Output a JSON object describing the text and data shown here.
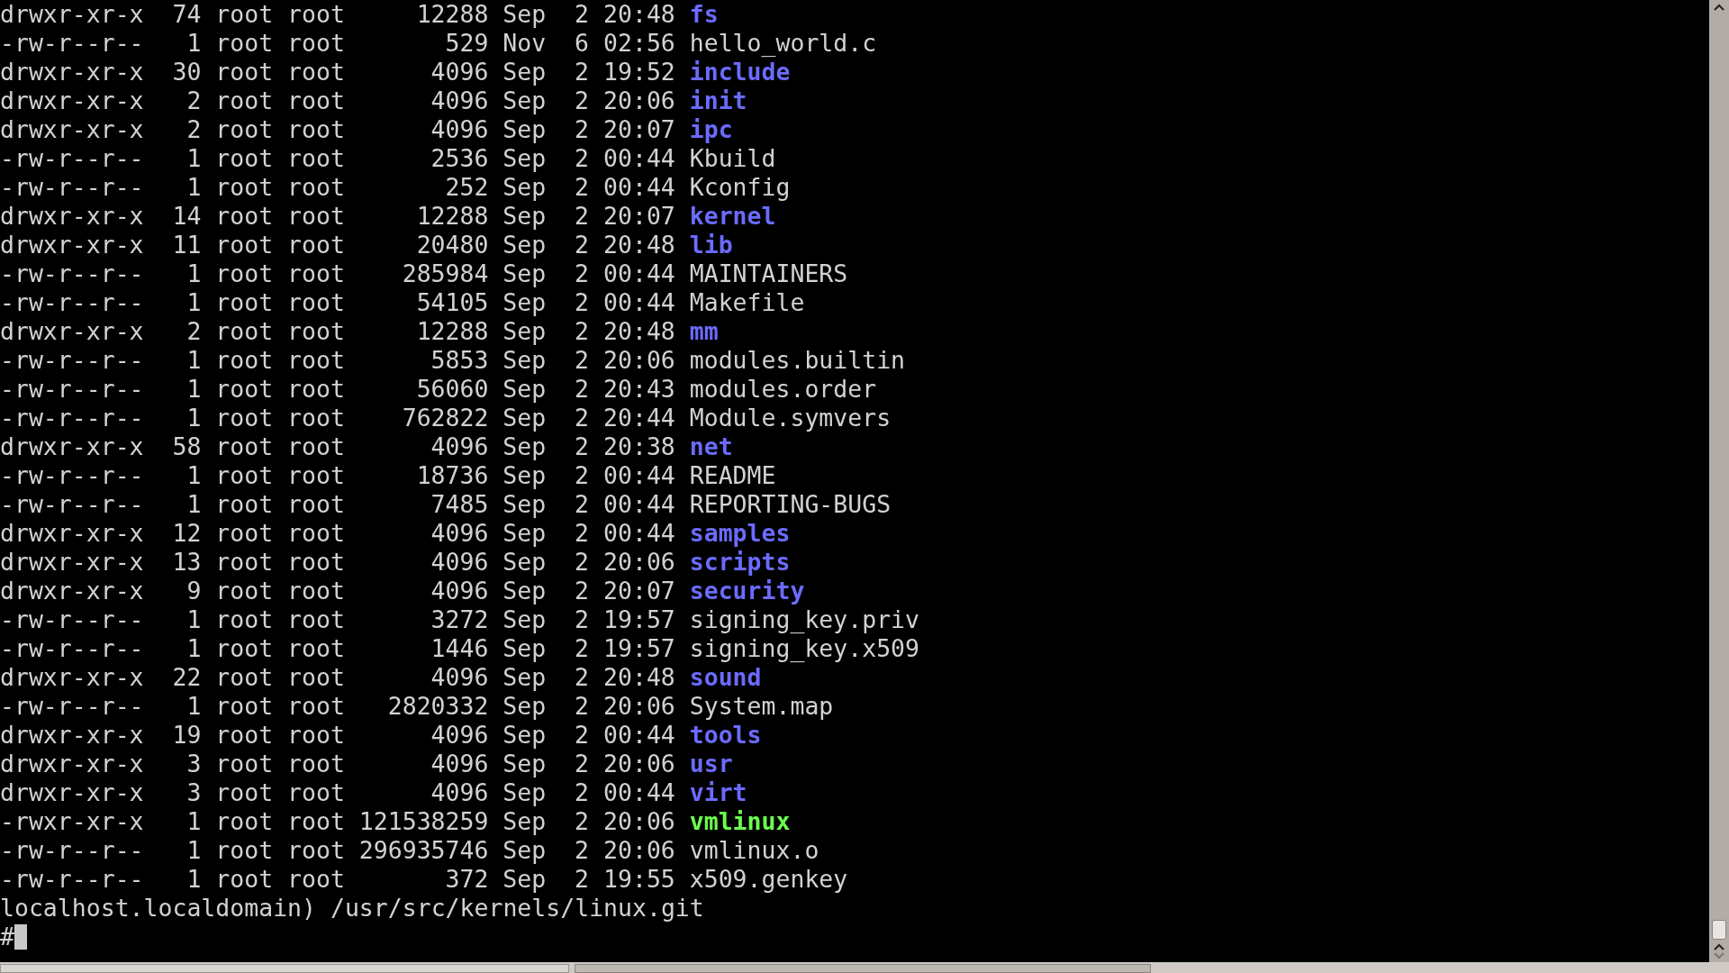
{
  "listing": [
    {
      "perms": "drwxr-xr-x",
      "links": "74",
      "owner": "root",
      "group": "root",
      "size": "12288",
      "month": "Sep",
      "day": "2",
      "time": "20:48",
      "name": "fs",
      "kind": "dir"
    },
    {
      "perms": "-rw-r--r--",
      "links": "1",
      "owner": "root",
      "group": "root",
      "size": "529",
      "month": "Nov",
      "day": "6",
      "time": "02:56",
      "name": "hello_world.c",
      "kind": "file"
    },
    {
      "perms": "drwxr-xr-x",
      "links": "30",
      "owner": "root",
      "group": "root",
      "size": "4096",
      "month": "Sep",
      "day": "2",
      "time": "19:52",
      "name": "include",
      "kind": "dir"
    },
    {
      "perms": "drwxr-xr-x",
      "links": "2",
      "owner": "root",
      "group": "root",
      "size": "4096",
      "month": "Sep",
      "day": "2",
      "time": "20:06",
      "name": "init",
      "kind": "dir"
    },
    {
      "perms": "drwxr-xr-x",
      "links": "2",
      "owner": "root",
      "group": "root",
      "size": "4096",
      "month": "Sep",
      "day": "2",
      "time": "20:07",
      "name": "ipc",
      "kind": "dir"
    },
    {
      "perms": "-rw-r--r--",
      "links": "1",
      "owner": "root",
      "group": "root",
      "size": "2536",
      "month": "Sep",
      "day": "2",
      "time": "00:44",
      "name": "Kbuild",
      "kind": "file"
    },
    {
      "perms": "-rw-r--r--",
      "links": "1",
      "owner": "root",
      "group": "root",
      "size": "252",
      "month": "Sep",
      "day": "2",
      "time": "00:44",
      "name": "Kconfig",
      "kind": "file"
    },
    {
      "perms": "drwxr-xr-x",
      "links": "14",
      "owner": "root",
      "group": "root",
      "size": "12288",
      "month": "Sep",
      "day": "2",
      "time": "20:07",
      "name": "kernel",
      "kind": "dir"
    },
    {
      "perms": "drwxr-xr-x",
      "links": "11",
      "owner": "root",
      "group": "root",
      "size": "20480",
      "month": "Sep",
      "day": "2",
      "time": "20:48",
      "name": "lib",
      "kind": "dir"
    },
    {
      "perms": "-rw-r--r--",
      "links": "1",
      "owner": "root",
      "group": "root",
      "size": "285984",
      "month": "Sep",
      "day": "2",
      "time": "00:44",
      "name": "MAINTAINERS",
      "kind": "file"
    },
    {
      "perms": "-rw-r--r--",
      "links": "1",
      "owner": "root",
      "group": "root",
      "size": "54105",
      "month": "Sep",
      "day": "2",
      "time": "00:44",
      "name": "Makefile",
      "kind": "file"
    },
    {
      "perms": "drwxr-xr-x",
      "links": "2",
      "owner": "root",
      "group": "root",
      "size": "12288",
      "month": "Sep",
      "day": "2",
      "time": "20:48",
      "name": "mm",
      "kind": "dir"
    },
    {
      "perms": "-rw-r--r--",
      "links": "1",
      "owner": "root",
      "group": "root",
      "size": "5853",
      "month": "Sep",
      "day": "2",
      "time": "20:06",
      "name": "modules.builtin",
      "kind": "file"
    },
    {
      "perms": "-rw-r--r--",
      "links": "1",
      "owner": "root",
      "group": "root",
      "size": "56060",
      "month": "Sep",
      "day": "2",
      "time": "20:43",
      "name": "modules.order",
      "kind": "file"
    },
    {
      "perms": "-rw-r--r--",
      "links": "1",
      "owner": "root",
      "group": "root",
      "size": "762822",
      "month": "Sep",
      "day": "2",
      "time": "20:44",
      "name": "Module.symvers",
      "kind": "file"
    },
    {
      "perms": "drwxr-xr-x",
      "links": "58",
      "owner": "root",
      "group": "root",
      "size": "4096",
      "month": "Sep",
      "day": "2",
      "time": "20:38",
      "name": "net",
      "kind": "dir"
    },
    {
      "perms": "-rw-r--r--",
      "links": "1",
      "owner": "root",
      "group": "root",
      "size": "18736",
      "month": "Sep",
      "day": "2",
      "time": "00:44",
      "name": "README",
      "kind": "file"
    },
    {
      "perms": "-rw-r--r--",
      "links": "1",
      "owner": "root",
      "group": "root",
      "size": "7485",
      "month": "Sep",
      "day": "2",
      "time": "00:44",
      "name": "REPORTING-BUGS",
      "kind": "file"
    },
    {
      "perms": "drwxr-xr-x",
      "links": "12",
      "owner": "root",
      "group": "root",
      "size": "4096",
      "month": "Sep",
      "day": "2",
      "time": "00:44",
      "name": "samples",
      "kind": "dir"
    },
    {
      "perms": "drwxr-xr-x",
      "links": "13",
      "owner": "root",
      "group": "root",
      "size": "4096",
      "month": "Sep",
      "day": "2",
      "time": "20:06",
      "name": "scripts",
      "kind": "dir"
    },
    {
      "perms": "drwxr-xr-x",
      "links": "9",
      "owner": "root",
      "group": "root",
      "size": "4096",
      "month": "Sep",
      "day": "2",
      "time": "20:07",
      "name": "security",
      "kind": "dir"
    },
    {
      "perms": "-rw-r--r--",
      "links": "1",
      "owner": "root",
      "group": "root",
      "size": "3272",
      "month": "Sep",
      "day": "2",
      "time": "19:57",
      "name": "signing_key.priv",
      "kind": "file"
    },
    {
      "perms": "-rw-r--r--",
      "links": "1",
      "owner": "root",
      "group": "root",
      "size": "1446",
      "month": "Sep",
      "day": "2",
      "time": "19:57",
      "name": "signing_key.x509",
      "kind": "file"
    },
    {
      "perms": "drwxr-xr-x",
      "links": "22",
      "owner": "root",
      "group": "root",
      "size": "4096",
      "month": "Sep",
      "day": "2",
      "time": "20:48",
      "name": "sound",
      "kind": "dir"
    },
    {
      "perms": "-rw-r--r--",
      "links": "1",
      "owner": "root",
      "group": "root",
      "size": "2820332",
      "month": "Sep",
      "day": "2",
      "time": "20:06",
      "name": "System.map",
      "kind": "file"
    },
    {
      "perms": "drwxr-xr-x",
      "links": "19",
      "owner": "root",
      "group": "root",
      "size": "4096",
      "month": "Sep",
      "day": "2",
      "time": "00:44",
      "name": "tools",
      "kind": "dir"
    },
    {
      "perms": "drwxr-xr-x",
      "links": "3",
      "owner": "root",
      "group": "root",
      "size": "4096",
      "month": "Sep",
      "day": "2",
      "time": "20:06",
      "name": "usr",
      "kind": "dir"
    },
    {
      "perms": "drwxr-xr-x",
      "links": "3",
      "owner": "root",
      "group": "root",
      "size": "4096",
      "month": "Sep",
      "day": "2",
      "time": "00:44",
      "name": "virt",
      "kind": "dir"
    },
    {
      "perms": "-rwxr-xr-x",
      "links": "1",
      "owner": "root",
      "group": "root",
      "size": "121538259",
      "month": "Sep",
      "day": "2",
      "time": "20:06",
      "name": "vmlinux",
      "kind": "exec"
    },
    {
      "perms": "-rw-r--r--",
      "links": "1",
      "owner": "root",
      "group": "root",
      "size": "296935746",
      "month": "Sep",
      "day": "2",
      "time": "20:06",
      "name": "vmlinux.o",
      "kind": "file"
    },
    {
      "perms": "-rw-r--r--",
      "links": "1",
      "owner": "root",
      "group": "root",
      "size": "372",
      "month": "Sep",
      "day": "2",
      "time": "19:55",
      "name": "x509.genkey",
      "kind": "file"
    }
  ],
  "prompt_path": "localhost.localdomain) /usr/src/kernels/linux.git",
  "prompt_symbol": "#"
}
